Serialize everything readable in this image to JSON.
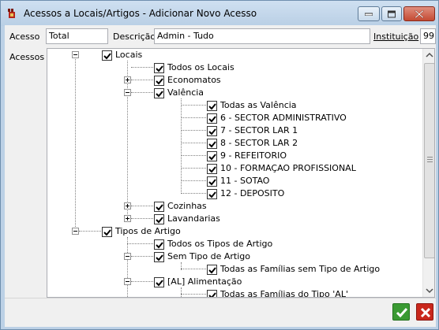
{
  "window": {
    "title": "Acessos a Locais/Artigos - Adicionar Novo Acesso"
  },
  "form": {
    "acesso_label": "Acesso",
    "acesso_value": "Total",
    "descricao_label": "Descrição",
    "descricao_value": "Admin - Tudo",
    "instituicao_label": "Instituição",
    "instituicao_value": "99",
    "acessos_label": "Acessos"
  },
  "tree": {
    "locais": "Locais",
    "todos_locais": "Todos os Locais",
    "economatos": "Economatos",
    "valencia": "Valência",
    "valencia_items": [
      "Todas as Valência",
      "6 - SECTOR ADMINISTRATIVO",
      "7 - SECTOR LAR 1",
      "8 - SECTOR LAR 2",
      "9 - REFEITORIO",
      "10 - FORMAÇAO PROFISSIONAL",
      "11 - SOTAO",
      "12 - DEPOSITO"
    ],
    "cozinhas": "Cozinhas",
    "lavandarias": "Lavandarias",
    "tipos_artigo": "Tipos de Artigo",
    "todos_tipos": "Todos os Tipos de Artigo",
    "sem_tipo": "Sem Tipo de Artigo",
    "todas_familias_sem_tipo": "Todas as Famílias sem Tipo de Artigo",
    "alimentacao": "[AL] Alimentação",
    "todas_familias_al": "Todas as Famílias do Tipo 'AL'"
  },
  "colors": {
    "ok": "#3a9a33",
    "cancel": "#c9271c",
    "titlebar": "#bcd1e6"
  }
}
